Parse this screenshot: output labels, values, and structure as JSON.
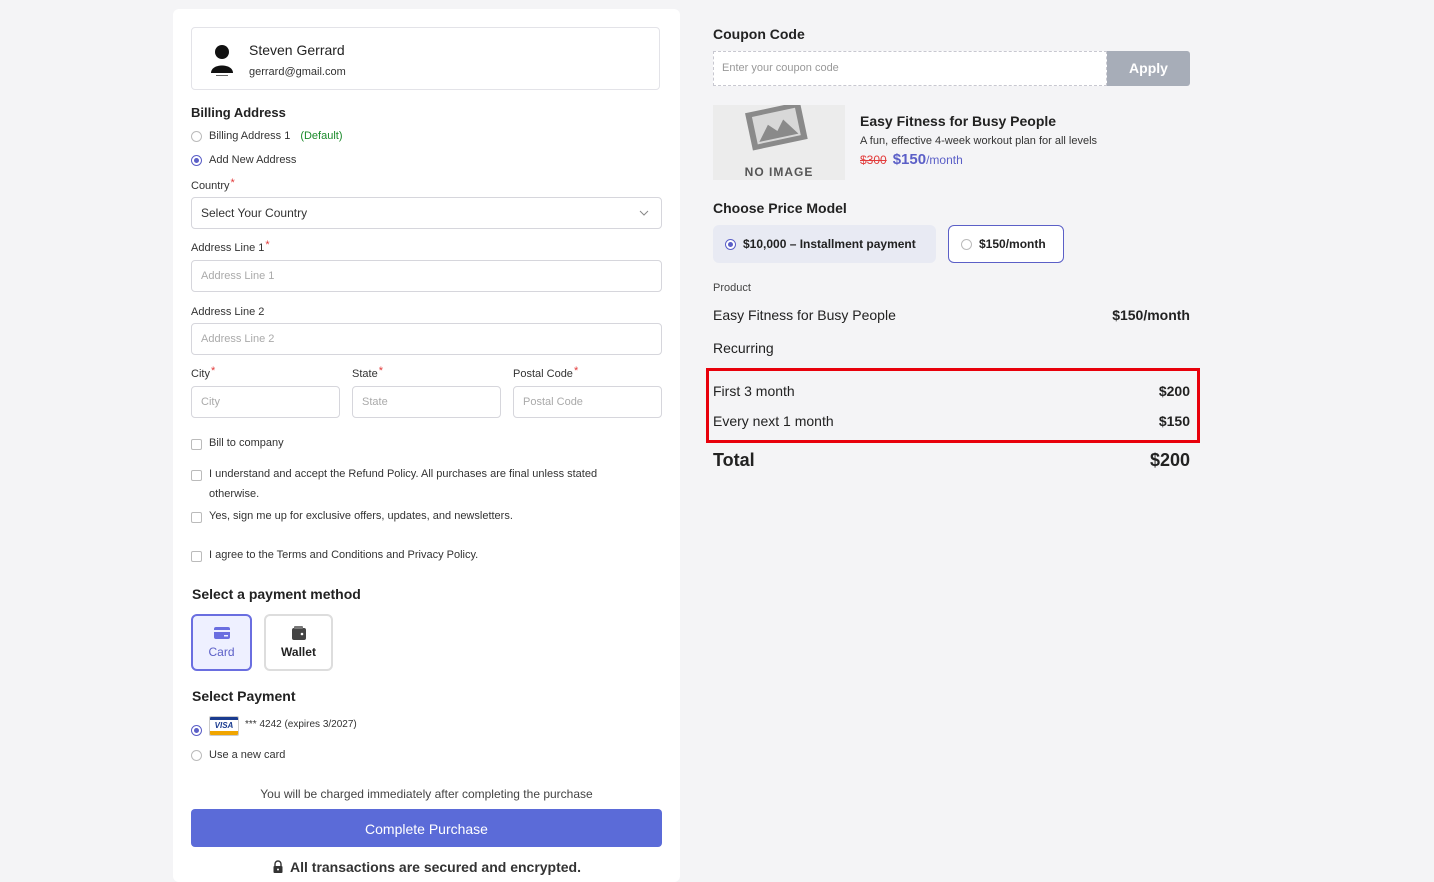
{
  "user": {
    "name": "Steven Gerrard",
    "email": "gerrard@gmail.com"
  },
  "billing": {
    "title": "Billing Address",
    "options": [
      {
        "label": "Billing Address 1",
        "tag": "(Default)",
        "selected": false
      },
      {
        "label": "Add New Address",
        "selected": true
      }
    ]
  },
  "form": {
    "country_label": "Country",
    "country_value": "Select Your Country",
    "address1_label": "Address Line 1",
    "address1_placeholder": "Address Line 1",
    "address2_label": "Address Line 2",
    "address2_placeholder": "Address Line 2",
    "city_label": "City",
    "city_placeholder": "City",
    "state_label": "State",
    "state_placeholder": "State",
    "postal_label": "Postal Code",
    "postal_placeholder": "Postal Code",
    "required_mark": "*"
  },
  "checks": {
    "bill_company": "Bill to company",
    "refund": "I understand and accept the Refund Policy. All purchases are final unless stated otherwise.",
    "newsletter": "Yes, sign me up for exclusive offers, updates, and newsletters.",
    "terms": "I agree to the Terms and Conditions and Privacy Policy."
  },
  "payment_method": {
    "title": "Select a payment method",
    "card_label": "Card",
    "wallet_label": "Wallet"
  },
  "select_payment": {
    "title": "Select Payment",
    "saved_card": "*** 4242  (expires 3/2027)",
    "visa_text": "VISA",
    "new_card": "Use a new card"
  },
  "charge_note": "You will be charged immediately after completing the purchase",
  "complete_button": "Complete Purchase",
  "secure_note": "All transactions are secured and encrypted.",
  "coupon": {
    "title": "Coupon Code",
    "placeholder": "Enter your coupon code",
    "apply": "Apply"
  },
  "product": {
    "no_image": "NO IMAGE",
    "name": "Easy Fitness for Busy People",
    "description": "A fun, effective 4-week workout plan for all levels",
    "old_price": "$300",
    "new_price": "$150",
    "per": "/month"
  },
  "price_model": {
    "title": "Choose Price Model",
    "option_a": "$10,000 – Installment payment",
    "option_b": "$150/month",
    "selected": "option_a"
  },
  "summary": {
    "product_label": "Product",
    "product_name": "Easy Fitness for Busy People",
    "product_price": "$150/month",
    "recurring_label": "Recurring",
    "first_label": "First 3 month",
    "first_value": "$200",
    "next_label": "Every next 1 month",
    "next_value": "$150",
    "total_label": "Total",
    "total_value": "$200"
  },
  "colors": {
    "accent": "#5b5fc7",
    "button": "#5b6bd8",
    "highlight": "#e8000b",
    "default_tag": "#1a8a2a"
  }
}
